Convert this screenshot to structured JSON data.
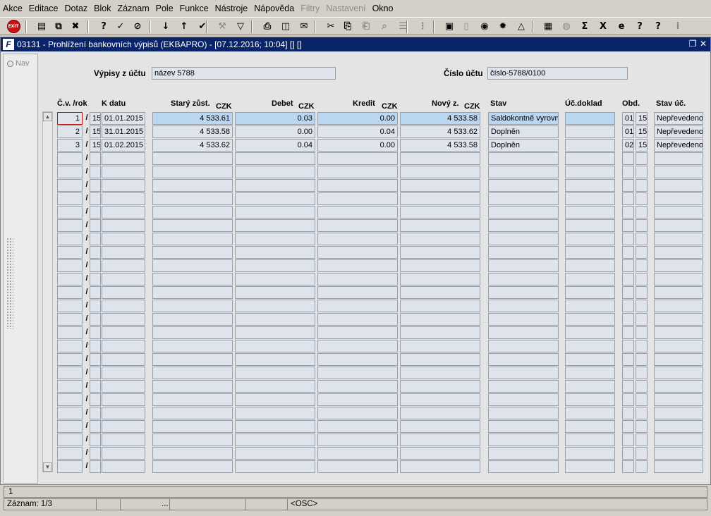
{
  "menu": [
    "Akce",
    "Editace",
    "Dotaz",
    "Blok",
    "Záznam",
    "Pole",
    "Funkce",
    "Nástroje",
    "Nápověda",
    "Filtry",
    "Nastavení",
    "Okno"
  ],
  "menu_disabled": [
    "Filtry",
    "Nastavení"
  ],
  "toolbar": {
    "exit_label": "EXIT",
    "icons": [
      "add-record-icon",
      "duplicate-record-icon",
      "delete-record-icon",
      "query-icon",
      "execute-query-icon",
      "cancel-query-icon",
      "sort-asc-icon",
      "sort-desc-icon",
      "commit-check-icon",
      "tools-icon",
      "filter-icon",
      "print-icon",
      "preview-icon",
      "mail-icon",
      "cut-icon",
      "copy-icon",
      "paste-icon",
      "search-icon",
      "list-icon",
      "tree-icon",
      "clipboard-icon",
      "document-icon",
      "globe-icon",
      "settings-icon",
      "triangle-icon",
      "chart-icon",
      "disk-icon",
      "sum-icon",
      "excel-icon",
      "browser-icon",
      "help-icon",
      "whatsthis-icon",
      "info-icon"
    ]
  },
  "window": {
    "title": "03131 - Prohlížení bankovních výpisů (EKBAPRO) - [07.12.2016; 10:04]  [] []",
    "logo": "F"
  },
  "nav": {
    "label": "Nav"
  },
  "form": {
    "account_label": "Výpisy z účtu",
    "account_value": "název 5788",
    "number_label": "Číslo účtu",
    "number_value": "číslo-5788/0100"
  },
  "columns": {
    "cv": "Č.v. /rok",
    "kdatu": "K datu",
    "stary": "Starý zůst.",
    "debet": "Debet",
    "kredit": "Kredit",
    "novy": "Nový z.",
    "currency": "CZK",
    "stav": "Stav",
    "ucdoklad": "Úč.doklad",
    "obd": "Obd.",
    "stavuc": "Stav úč."
  },
  "rows": [
    {
      "cv": "1",
      "rok": "15",
      "kdatu": "01.01.2015",
      "stary": "4 533.61",
      "debet": "0.03",
      "kredit": "0.00",
      "novy": "4 533.58",
      "stav": "Saldokontně vyrovn",
      "ucdoklad": "",
      "obd1": "01",
      "obd2": "15",
      "stavuc": "Nepřevedeno"
    },
    {
      "cv": "2",
      "rok": "15",
      "kdatu": "31.01.2015",
      "stary": "4 533.58",
      "debet": "0.00",
      "kredit": "0.04",
      "novy": "4 533.62",
      "stav": "Doplněn",
      "ucdoklad": "",
      "obd1": "01",
      "obd2": "15",
      "stavuc": "Nepřevedeno"
    },
    {
      "cv": "3",
      "rok": "15",
      "kdatu": "01.02.2015",
      "stary": "4 533.62",
      "debet": "0.04",
      "kredit": "0.00",
      "novy": "4 533.58",
      "stav": "Doplněn",
      "ucdoklad": "",
      "obd1": "02",
      "obd2": "15",
      "stavuc": "Nepřevedeno"
    }
  ],
  "status": {
    "message": "1",
    "record": "Záznam: 1/3",
    "ellipsis": "...",
    "mode": "<OSC>"
  }
}
